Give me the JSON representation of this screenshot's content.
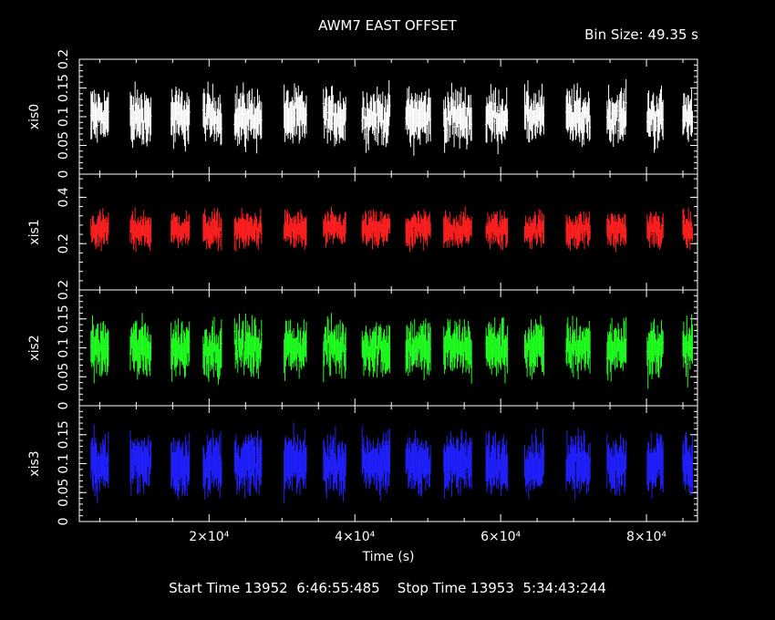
{
  "header": {
    "title": "AWM7 EAST OFFSET",
    "bin_size": "Bin Size: 49.35 s"
  },
  "footer": {
    "times": "Start Time 13952  6:46:55:485    Stop Time 13953  5:34:43:244"
  },
  "colors": {
    "axes": "#ffffff",
    "xis0": "#ffffff",
    "xis1": "#ff2020",
    "xis2": "#20ff20",
    "xis3": "#2020ff"
  },
  "chart_data": {
    "type": "scatter",
    "xlabel": "Time (s)",
    "x_ticks": [
      {
        "value": 20000,
        "label": "2×10⁴"
      },
      {
        "value": 40000,
        "label": "4×10⁴"
      },
      {
        "value": 60000,
        "label": "6×10⁴"
      },
      {
        "value": 80000,
        "label": "8×10⁴"
      }
    ],
    "xlim": [
      2200,
      87000
    ],
    "segments": [
      [
        3800,
        6200
      ],
      [
        9200,
        12100
      ],
      [
        14800,
        17300
      ],
      [
        19200,
        21800
      ],
      [
        23500,
        27200
      ],
      [
        30300,
        33400
      ],
      [
        35700,
        38800
      ],
      [
        41000,
        44800
      ],
      [
        47000,
        50400
      ],
      [
        52200,
        56000
      ],
      [
        58000,
        61000
      ],
      [
        63300,
        66000
      ],
      [
        69000,
        72300
      ],
      [
        74600,
        77300
      ],
      [
        80100,
        82300
      ],
      [
        85000,
        86400
      ]
    ],
    "panels": [
      {
        "ylabel": "xis0",
        "color_key": "xis0",
        "ylim": [
          0,
          0.2
        ],
        "y_ticks": [
          "0",
          "0.05",
          "0.1",
          "0.15",
          "0.2"
        ],
        "y_tick_values": [
          0,
          0.05,
          0.1,
          0.15,
          0.2
        ],
        "tick_format": "stacked",
        "mean": 0.1,
        "spread": 0.035,
        "err": 0.03
      },
      {
        "ylabel": "xis1",
        "color_key": "xis1",
        "ylim": [
          0,
          0.5
        ],
        "y_ticks": [
          "0.2",
          "0.4"
        ],
        "y_tick_values": [
          0.2,
          0.4
        ],
        "tick_format": "sparse",
        "mean": 0.26,
        "spread": 0.05,
        "err": 0.05
      },
      {
        "ylabel": "xis2",
        "color_key": "xis2",
        "ylim": [
          0,
          0.2
        ],
        "y_ticks": [
          "0",
          "0.05",
          "0.1",
          "0.15",
          "0.2"
        ],
        "y_tick_values": [
          0,
          0.05,
          0.1,
          0.15,
          0.2
        ],
        "tick_format": "stacked",
        "mean": 0.1,
        "spread": 0.035,
        "err": 0.03
      },
      {
        "ylabel": "xis3",
        "color_key": "xis3",
        "ylim": [
          0,
          0.2
        ],
        "y_ticks": [
          "0",
          "0.05",
          "0.1",
          "0.15"
        ],
        "y_tick_values": [
          0,
          0.05,
          0.1,
          0.15
        ],
        "tick_format": "stacked",
        "mean": 0.1,
        "spread": 0.03,
        "err": 0.035
      }
    ]
  }
}
